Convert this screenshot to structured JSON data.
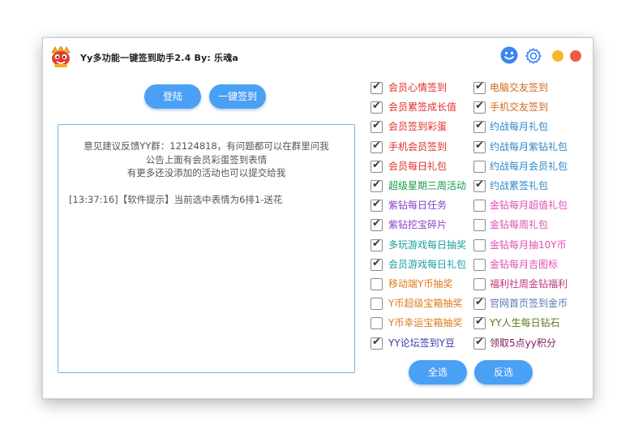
{
  "app": {
    "title": "Yy多功能一键签到助手2.4 By: 乐魂a"
  },
  "buttons": {
    "login": "登陆",
    "sign_all": "一键签到",
    "select_all": "全选",
    "invert": "反选"
  },
  "log": {
    "notice_lines": [
      "意见建议反馈YY群：12124818，有问题都可以在群里问我",
      "公告上面有会员彩蛋签到表情",
      "有更多还没添加的活动也可以提交给我"
    ],
    "entries": [
      "[13:37:16]【软件提示】当前选中表情为6排1-送花"
    ]
  },
  "tasks": [
    {
      "label": "会员心情签到",
      "checked": true,
      "color": "#e0302a"
    },
    {
      "label": "电脑交友签到",
      "checked": true,
      "color": "#d2691e"
    },
    {
      "label": "会员累签成长值",
      "checked": true,
      "color": "#e0302a"
    },
    {
      "label": "手机交友签到",
      "checked": true,
      "color": "#d2691e"
    },
    {
      "label": "会员签到彩蛋",
      "checked": true,
      "color": "#e0302a"
    },
    {
      "label": "约战每月礼包",
      "checked": true,
      "color": "#2b86c8"
    },
    {
      "label": "手机会员签到",
      "checked": true,
      "color": "#e0302a"
    },
    {
      "label": "约战每月紫钻礼包",
      "checked": true,
      "color": "#2b86c8"
    },
    {
      "label": "会员每日礼包",
      "checked": true,
      "color": "#e0302a"
    },
    {
      "label": "约战每月会员礼包",
      "checked": false,
      "color": "#2b86c8"
    },
    {
      "label": "超级星期三周活动",
      "checked": true,
      "color": "#1a9a4a"
    },
    {
      "label": "约战累签礼包",
      "checked": true,
      "color": "#2b86c8"
    },
    {
      "label": "紫钻每日任务",
      "checked": true,
      "color": "#8a3fc9"
    },
    {
      "label": "金钻每月超值礼包",
      "checked": false,
      "color": "#e04fb0"
    },
    {
      "label": "紫钻挖宝碎片",
      "checked": true,
      "color": "#8a3fc9"
    },
    {
      "label": "金钻每周礼包",
      "checked": false,
      "color": "#e04fb0"
    },
    {
      "label": "多玩游戏每日抽奖",
      "checked": true,
      "color": "#1aa0a0"
    },
    {
      "label": "金钻每月抽10Y币",
      "checked": false,
      "color": "#e04fb0"
    },
    {
      "label": "会员游戏每日礼包",
      "checked": true,
      "color": "#1aa0a0"
    },
    {
      "label": "金钻每月吉图标",
      "checked": false,
      "color": "#e04fb0"
    },
    {
      "label": "移动端Y币抽奖",
      "checked": false,
      "color": "#e07a1a"
    },
    {
      "label": "福利社周金钻福利",
      "checked": false,
      "color": "#c2387a"
    },
    {
      "label": "Y币超级宝箱抽奖",
      "checked": false,
      "color": "#e07a1a"
    },
    {
      "label": "官网首页签到金币",
      "checked": true,
      "color": "#5a7ab0"
    },
    {
      "label": "Y币幸运宝箱抽奖",
      "checked": false,
      "color": "#e07a1a"
    },
    {
      "label": "YY人生每日钻石",
      "checked": true,
      "color": "#5a7a1a"
    },
    {
      "label": "YY论坛签到Y豆",
      "checked": true,
      "color": "#3a3ab0"
    },
    {
      "label": "领取5点yy积分",
      "checked": true,
      "color": "#7a1a5a"
    }
  ],
  "colors": {
    "accent": "#4aa0f5",
    "minimize": "#f9b62a",
    "close": "#f05a3f"
  },
  "icons": {
    "logo": "mascot-logo-icon",
    "face": "smiley-face-icon",
    "settings": "gear-icon"
  }
}
